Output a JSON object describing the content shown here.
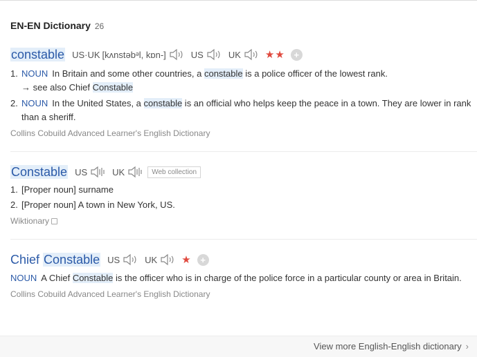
{
  "header": {
    "title": "EN-EN Dictionary",
    "count": "26"
  },
  "entry1": {
    "headword": "constable",
    "pron_label": "US·UK",
    "phonetic": "[kʌnstəbᵊl, kɒn-]",
    "us": "US",
    "uk": "UK",
    "stars": "★★",
    "plus": "+",
    "senses": [
      {
        "num": "1.",
        "pos": "NOUN",
        "pre": "In Britain and some other countries, a ",
        "hl": "constable",
        "post": " is a police officer of the lowest rank.",
        "see_pre": "→ see also Chief ",
        "see_hl": "Constable"
      },
      {
        "num": "2.",
        "pos": "NOUN",
        "pre": "In the United States, a ",
        "hl": "constable",
        "post": " is an official who helps keep the peace in a town. They are lower in rank than a sheriff."
      }
    ],
    "source": "Collins Cobuild Advanced Learner's English Dictionary"
  },
  "entry2": {
    "headword": "Constable",
    "us": "US",
    "uk": "UK",
    "web_collection": "Web collection",
    "senses": [
      {
        "num": "1.",
        "text": "[Proper noun] surname"
      },
      {
        "num": "2.",
        "text": "[Proper noun] A town in New York, US."
      }
    ],
    "source": "Wiktionary"
  },
  "entry3": {
    "headword_pre": "Chief",
    "headword_hl": "Constable",
    "us": "US",
    "uk": "UK",
    "stars": "★",
    "plus": "+",
    "pos": "NOUN",
    "pre": "A Chief ",
    "hl": "Constable",
    "post": " is the officer who is in charge of the police force in a particular county or area in Britain.",
    "source": "Collins Cobuild Advanced Learner's English Dictionary"
  },
  "footer": {
    "more": "View more English-English dictionary",
    "chevron": "›"
  },
  "colors": {
    "link": "#2b5aa8",
    "highlight": "#e3eef9",
    "star": "#e0493e"
  },
  "icons": [
    "speaker-icon",
    "speaker-wave-icon",
    "plus-icon",
    "copy-icon",
    "chevron-right-icon"
  ]
}
